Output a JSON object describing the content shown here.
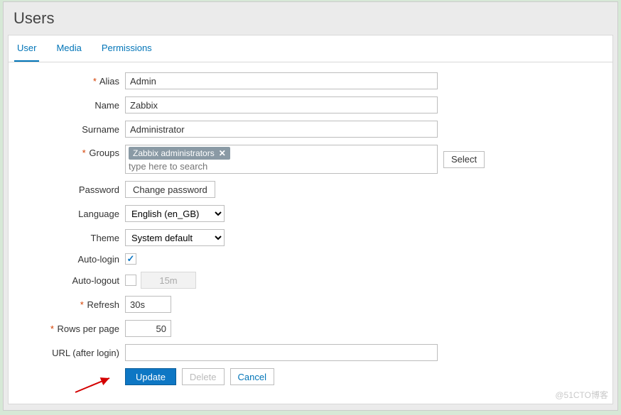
{
  "header": {
    "title": "Users"
  },
  "tabs": [
    {
      "id": "user",
      "label": "User",
      "active": true
    },
    {
      "id": "media",
      "label": "Media",
      "active": false
    },
    {
      "id": "permissions",
      "label": "Permissions",
      "active": false
    }
  ],
  "form": {
    "alias": {
      "label": "Alias",
      "required": true,
      "value": "Admin"
    },
    "name": {
      "label": "Name",
      "required": false,
      "value": "Zabbix"
    },
    "surname": {
      "label": "Surname",
      "required": false,
      "value": "Administrator"
    },
    "groups": {
      "label": "Groups",
      "required": true,
      "selected": [
        "Zabbix administrators"
      ],
      "placeholder": "type here to search",
      "select_btn": "Select"
    },
    "password": {
      "label": "Password",
      "button": "Change password"
    },
    "language": {
      "label": "Language",
      "value": "English (en_GB)"
    },
    "theme": {
      "label": "Theme",
      "value": "System default"
    },
    "autologin": {
      "label": "Auto-login",
      "checked": true
    },
    "autologout": {
      "label": "Auto-logout",
      "checked": false,
      "value": "15m"
    },
    "refresh": {
      "label": "Refresh",
      "required": true,
      "value": "30s"
    },
    "rows": {
      "label": "Rows per page",
      "required": true,
      "value": "50"
    },
    "url": {
      "label": "URL (after login)",
      "value": ""
    }
  },
  "actions": {
    "update": "Update",
    "delete": "Delete",
    "cancel": "Cancel"
  },
  "watermark": "@51CTO博客"
}
